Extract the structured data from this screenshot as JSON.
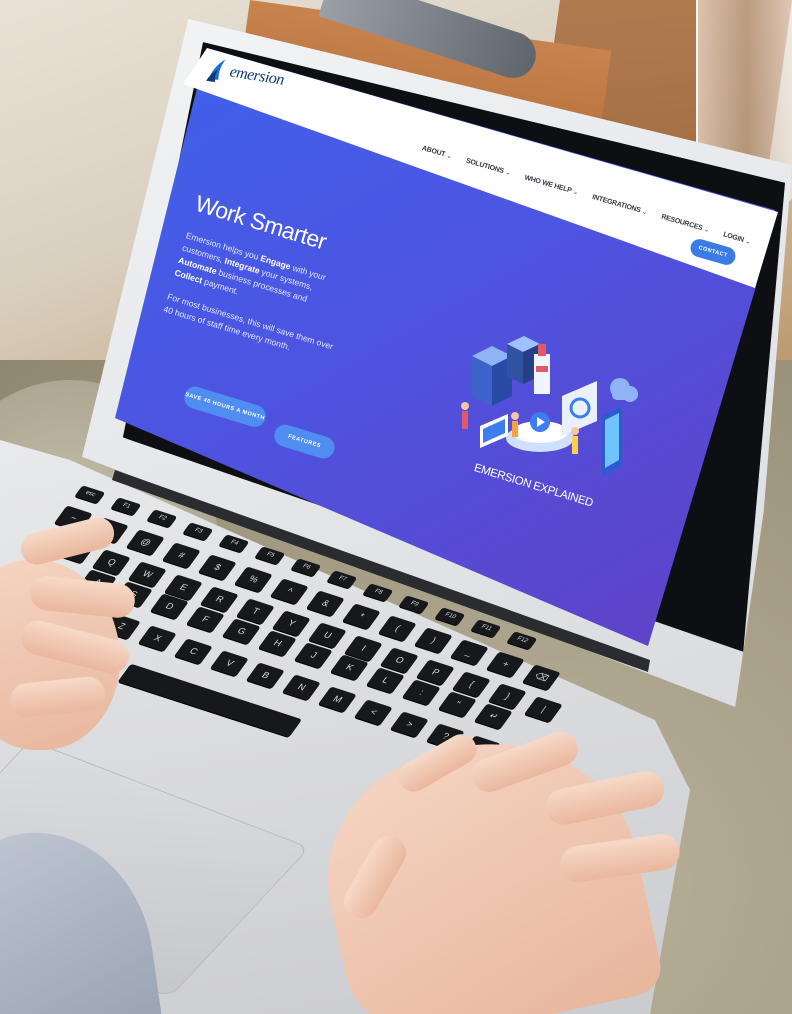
{
  "site": {
    "logo_text": "emersion",
    "nav": [
      {
        "label": "ABOUT",
        "chevron": "⌄"
      },
      {
        "label": "SOLUTIONS",
        "chevron": "⌄"
      },
      {
        "label": "WHO WE HELP",
        "chevron": "⌄"
      },
      {
        "label": "INTEGRATIONS",
        "chevron": "⌄"
      },
      {
        "label": "RESOURCES",
        "chevron": "⌄"
      },
      {
        "label": "LOGIN",
        "chevron": "⌄"
      }
    ],
    "contact_button": "CONTACT"
  },
  "hero": {
    "title": "Work Smarter",
    "p1_a": "Emersion helps you ",
    "p1_b": "Engage",
    "p1_c": " with your customers, ",
    "p1_d": "Integrate",
    "p1_e": " your systems, ",
    "p1_f": "Automate",
    "p1_g": " business processes and ",
    "p1_h": "Collect",
    "p1_i": " payment.",
    "p2": "For most businesses, this will save them over 40 hours of staff time every month.",
    "primary_button": "SAVE 40 HOURS A MONTH",
    "secondary_button": "FEATURES"
  },
  "illustration": {
    "caption": "EMERSION EXPLAINED"
  },
  "colors": {
    "gradient_start": "#3a66ec",
    "gradient_end": "#6f3fae",
    "button_blue": "#4f8ef0",
    "contact_blue": "#3a7be6",
    "logo_navy": "#0d3b73"
  },
  "keyboard": {
    "row_fn": [
      "esc",
      "F1",
      "F2",
      "F3",
      "F4",
      "F5",
      "F6",
      "F7",
      "F8",
      "F9",
      "F10",
      "F11",
      "F12"
    ],
    "row_num": [
      "~",
      "!",
      "@",
      "#",
      "$",
      "%",
      "^",
      "&",
      "*",
      "(",
      ")",
      "_",
      "+",
      "⌫"
    ],
    "row_q": [
      "⇥",
      "Q",
      "W",
      "E",
      "R",
      "T",
      "Y",
      "U",
      "I",
      "O",
      "P",
      "{",
      "}",
      "|"
    ],
    "row_a": [
      "A",
      "S",
      "D",
      "F",
      "G",
      "H",
      "J",
      "K",
      "L",
      ":",
      "\"",
      "↵"
    ],
    "row_z": [
      "⇧",
      "Z",
      "X",
      "C",
      "V",
      "B",
      "N",
      "M",
      "<",
      ">",
      "?",
      "⇧"
    ]
  }
}
